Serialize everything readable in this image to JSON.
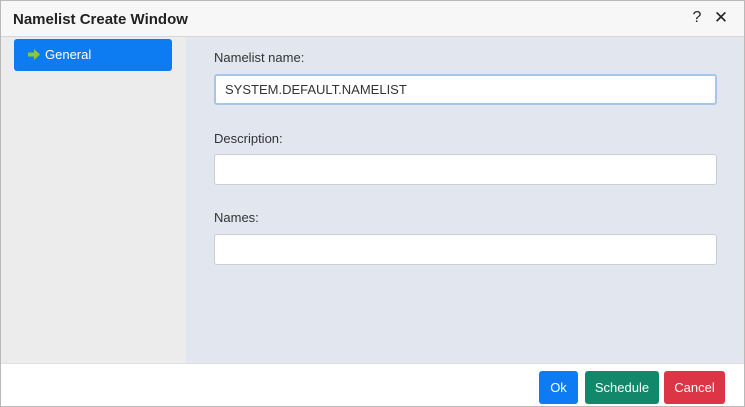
{
  "window": {
    "title": "Namelist Create Window",
    "help_label": "?",
    "close_label": "✕"
  },
  "sidebar": {
    "items": [
      {
        "label": "General",
        "icon": "arrow-right-icon",
        "selected": true
      }
    ]
  },
  "form": {
    "namelist_name": {
      "label": "Namelist name:",
      "value": "SYSTEM.DEFAULT.NAMELIST"
    },
    "description": {
      "label": "Description:",
      "value": ""
    },
    "names": {
      "label": "Names:",
      "value": ""
    }
  },
  "footer": {
    "ok_label": "Ok",
    "schedule_label": "Schedule",
    "cancel_label": "Cancel"
  },
  "colors": {
    "primary": "#0d7cf2",
    "schedule": "#12876a",
    "cancel": "#dc3545",
    "arrow": "#8fc43c"
  }
}
